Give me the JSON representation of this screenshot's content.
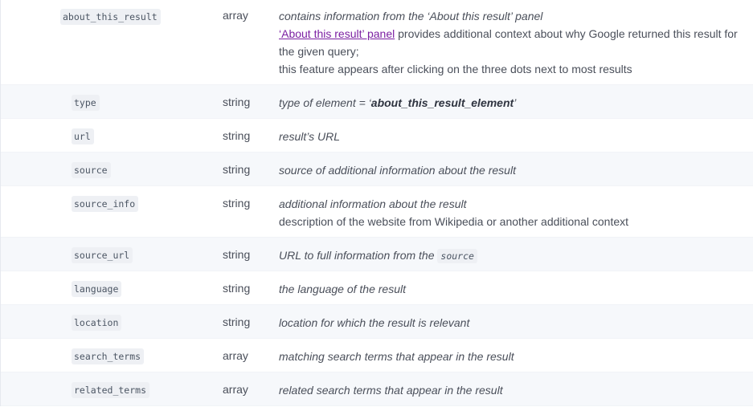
{
  "rows": [
    {
      "name": "about_this_result",
      "type": "array",
      "desc": {
        "line1": "contains information from the ‘About this result’ panel",
        "link": "‘About this result’ panel",
        "line2_rest": " provides additional context about why Google returned this result for the given query;",
        "line3": "this feature appears after clicking on the three dots next to most results"
      }
    },
    {
      "name": "type",
      "type": "string",
      "desc": {
        "prefix": "type of element = ‘",
        "strong": "about_this_result_element",
        "suffix": "’"
      }
    },
    {
      "name": "url",
      "type": "string",
      "desc": "result’s URL"
    },
    {
      "name": "source",
      "type": "string",
      "desc": "source of additional information about the result"
    },
    {
      "name": "source_info",
      "type": "string",
      "desc": {
        "line1": "additional information about the result",
        "line2": "description of the website from Wikipedia or another additional context"
      }
    },
    {
      "name": "source_url",
      "type": "string",
      "desc": {
        "prefix": "URL to full information from the ",
        "code": "source"
      }
    },
    {
      "name": "language",
      "type": "string",
      "desc": "the language of the result"
    },
    {
      "name": "location",
      "type": "string",
      "desc": "location for which the result is relevant"
    },
    {
      "name": "search_terms",
      "type": "array",
      "desc": "matching search terms that appear in the result"
    },
    {
      "name": "related_terms",
      "type": "array",
      "desc": "related search terms that appear in the result"
    }
  ],
  "colors": {
    "alt_row_bg": "#f6f8fb",
    "code_bg": "#eef0f4",
    "link": "#7b1fa2",
    "text": "#4a4f5a"
  }
}
